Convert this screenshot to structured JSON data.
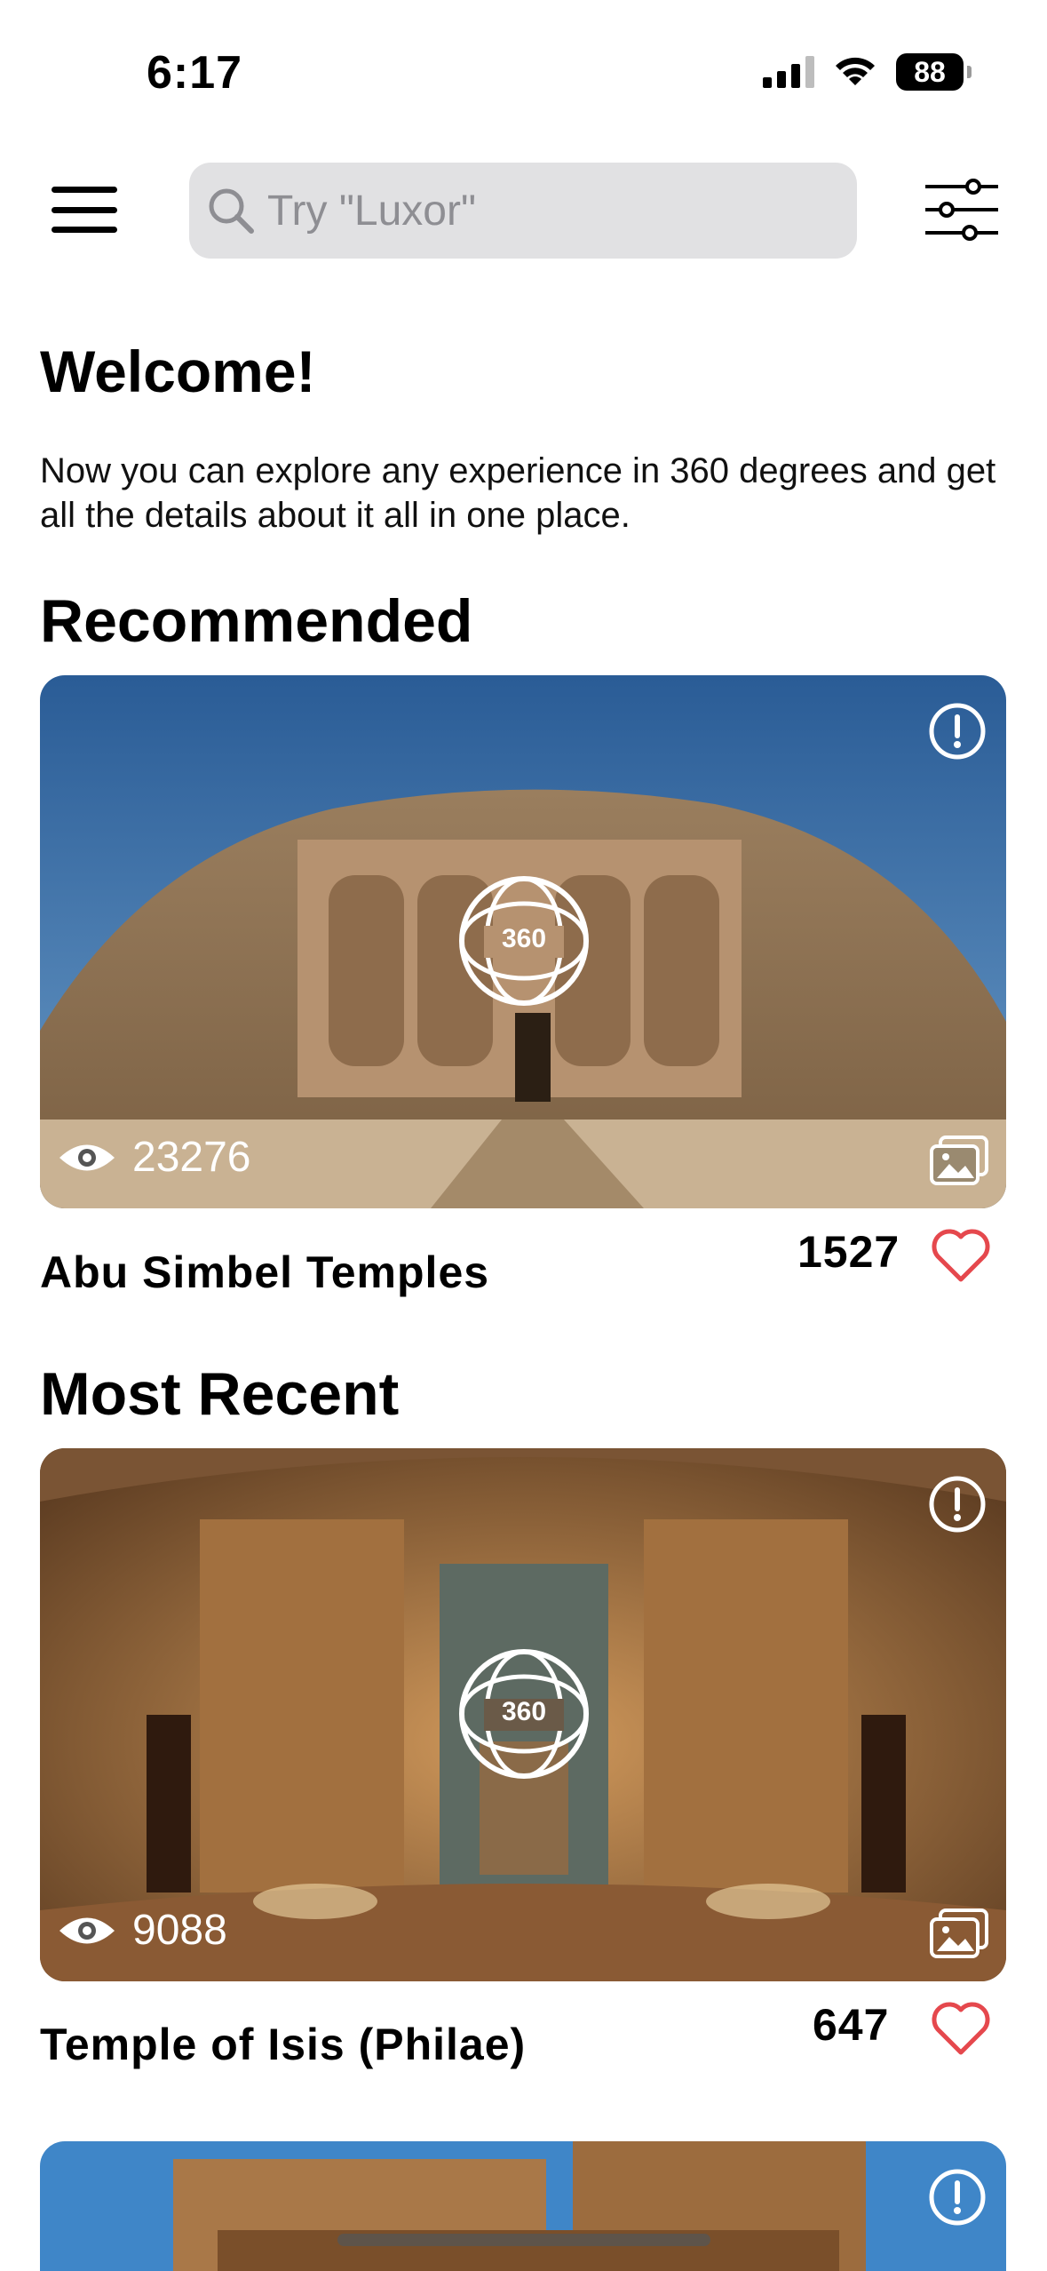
{
  "status_bar": {
    "time": "6:17",
    "battery": "88"
  },
  "search": {
    "placeholder": "Try \"Luxor\""
  },
  "welcome": {
    "title": "Welcome!",
    "text": "Now you can explore any experience in 360 degrees and get all the details about it all in one place."
  },
  "sections": {
    "recommended": "Recommended",
    "most_recent": "Most Recent"
  },
  "cards": [
    {
      "name": "Abu Simbel Temples",
      "views": "23276",
      "likes": "1527",
      "badge": "360"
    },
    {
      "name": "Temple of Isis (Philae)",
      "views": "9088",
      "likes": "647",
      "badge": "360"
    }
  ],
  "colors": {
    "heart": "#e5484d",
    "search_bg": "#e1e1e3",
    "accent_sky": "#2e6aa6"
  }
}
